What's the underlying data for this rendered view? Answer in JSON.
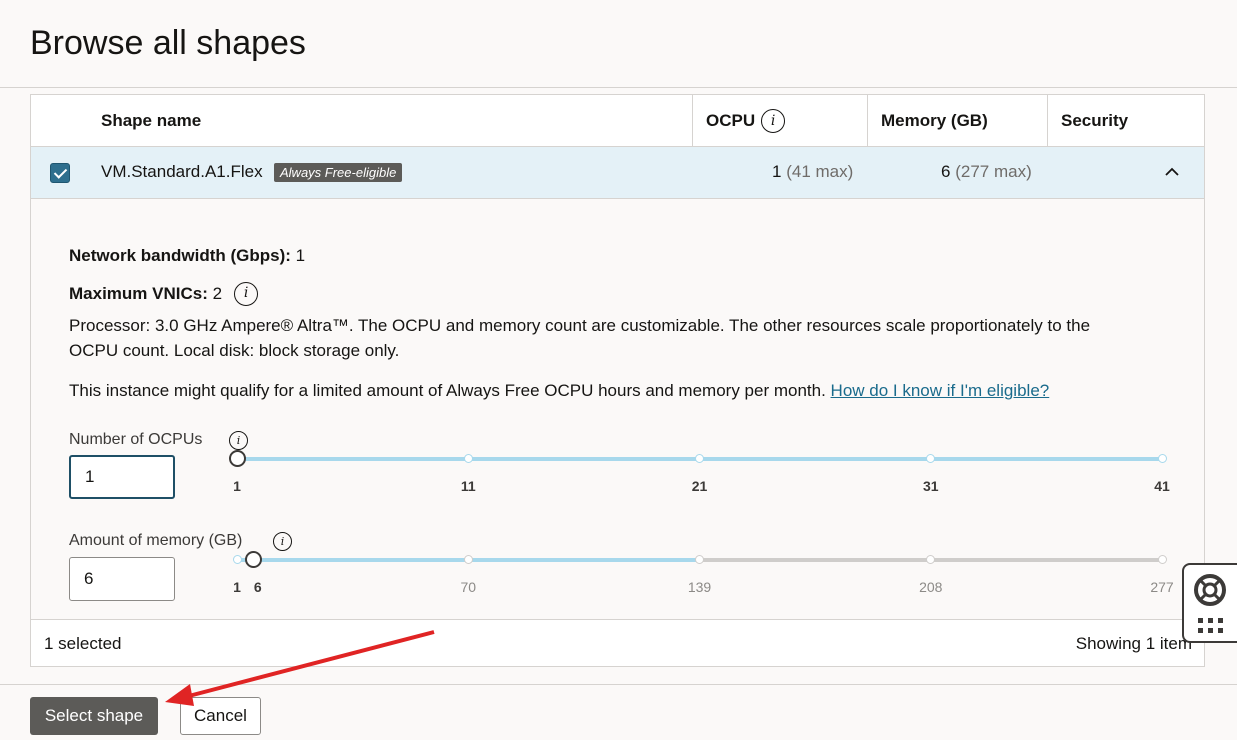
{
  "header": {
    "title": "Browse all shapes"
  },
  "table": {
    "columns": {
      "shape_name": "Shape name",
      "ocpu": "OCPU",
      "memory": "Memory (GB)",
      "security": "Security"
    },
    "row": {
      "name": "VM.Standard.A1.Flex",
      "badge": "Always Free-eligible",
      "ocpu_value": "1",
      "ocpu_max": "(41 max)",
      "memory_value": "6",
      "memory_max": "(277 max)",
      "selected": true
    },
    "detail": {
      "bandwidth_label": "Network bandwidth (Gbps):",
      "bandwidth_value": " 1",
      "vnics_label": "Maximum VNICs:",
      "vnics_value": " 2",
      "processor_line1": "Processor: 3.0 GHz Ampere® Altra™. The OCPU and memory count are customizable. The other resources scale proportionately to the",
      "processor_line2": "OCPU count. Local disk: block storage only.",
      "free_text": "This instance might qualify for a limited amount of Always Free OCPU hours and memory per month. ",
      "free_link": "How do I know if I'm eligible?",
      "ocpu_slider": {
        "label": "Number of OCPUs",
        "value": "1",
        "min": 1,
        "max": 41,
        "current": 1,
        "ticks": [
          "1",
          "11",
          "21",
          "31",
          "41"
        ]
      },
      "memory_slider": {
        "label": "Amount of memory (GB)",
        "value": "6",
        "min": 1,
        "max": 277,
        "current": 6,
        "allowed_max": 139,
        "ticks_left": [
          "1",
          "6"
        ],
        "ticks": [
          "70",
          "139",
          "208",
          "277"
        ]
      }
    },
    "footer": {
      "selected": "1 selected",
      "showing": "Showing 1 item"
    }
  },
  "buttons": {
    "select": "Select shape",
    "cancel": "Cancel"
  },
  "help_widget": {
    "icons": [
      "lifebuoy-icon",
      "grid-dots-icon"
    ]
  },
  "colors": {
    "accent": "#a7d8ec",
    "selected_row": "#e4f1f7",
    "primary_button": "#5c5b58",
    "annotation_arrow": "#e02424"
  }
}
